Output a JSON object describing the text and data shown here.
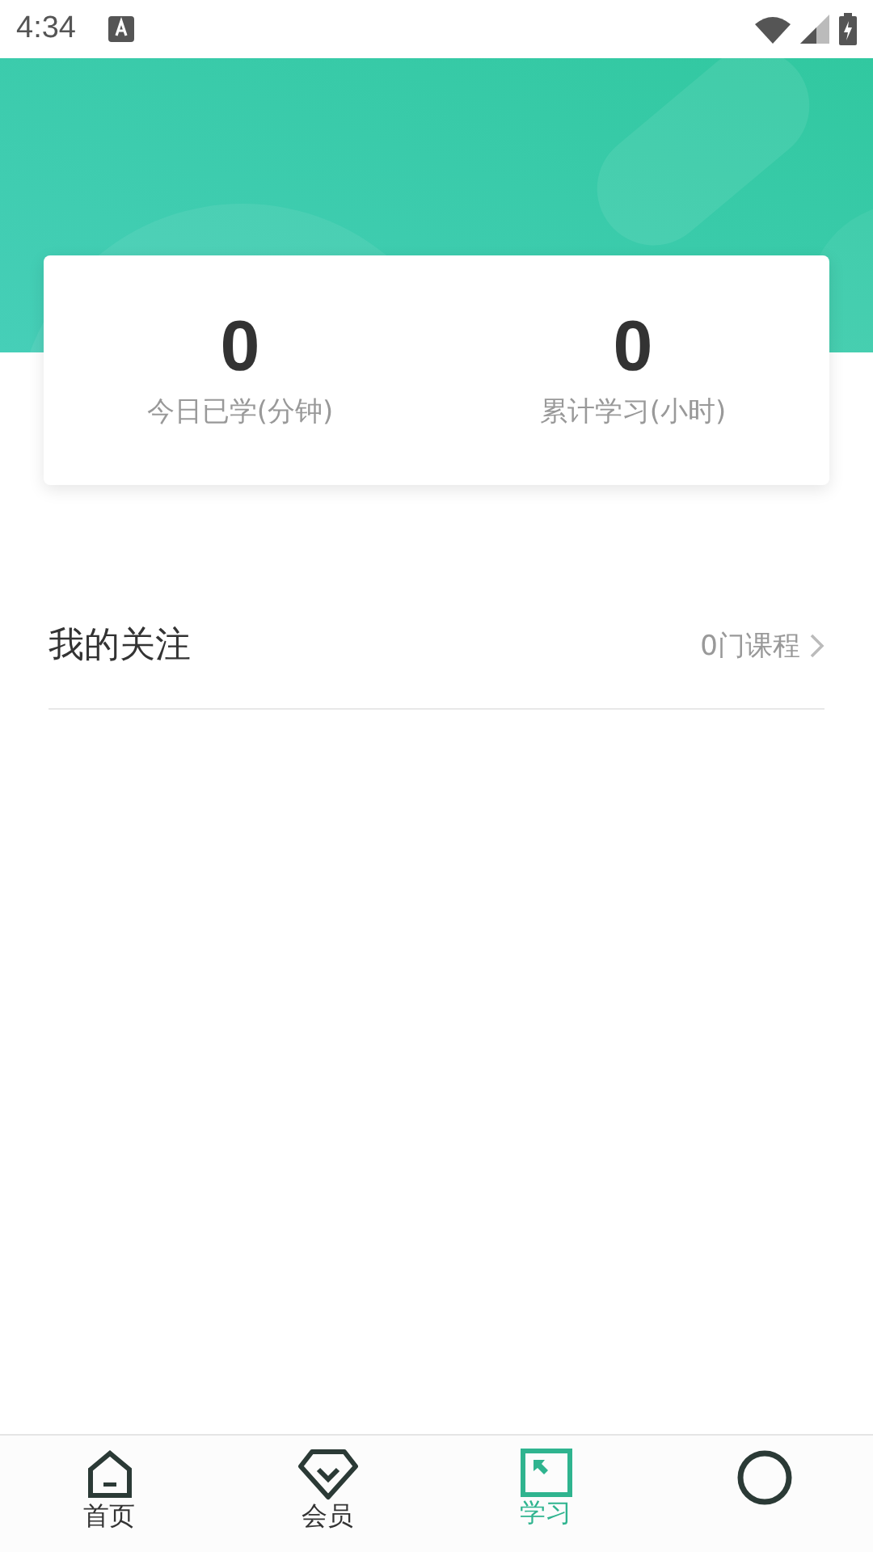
{
  "status_bar": {
    "time": "4:34"
  },
  "stats": [
    {
      "value": "0",
      "label": "今日已学(分钟)"
    },
    {
      "value": "0",
      "label": "累计学习(小时)"
    }
  ],
  "follow": {
    "title": "我的关注",
    "count": "0门课程"
  },
  "nav": [
    {
      "kind": "home",
      "label": "首页",
      "selected": false
    },
    {
      "kind": "vip",
      "label": "会员",
      "selected": false
    },
    {
      "kind": "study",
      "label": "学习",
      "selected": true
    },
    {
      "kind": "ring",
      "selected": false
    }
  ]
}
